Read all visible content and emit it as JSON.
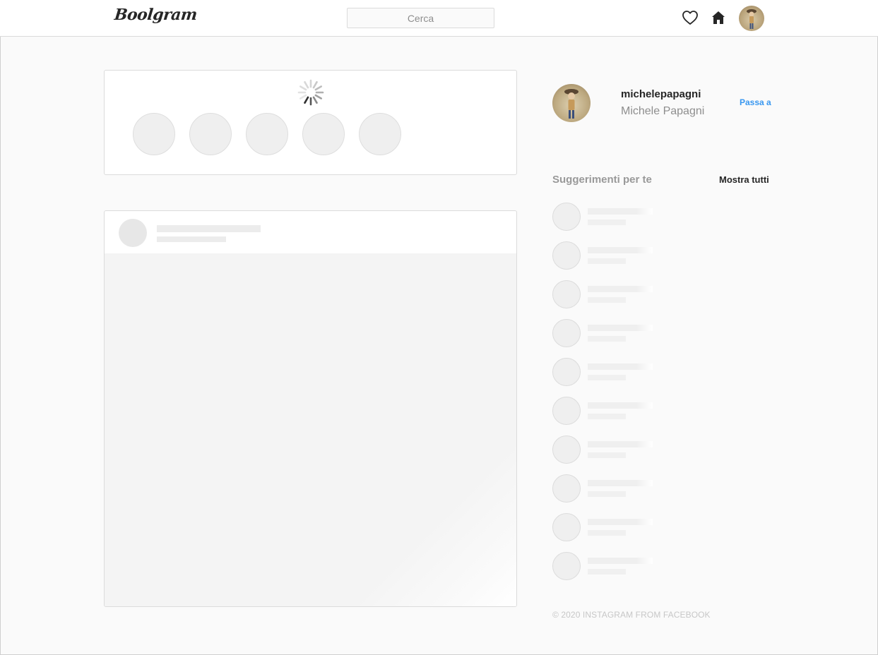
{
  "header": {
    "logo": "Boolgram",
    "search_placeholder": "Cerca",
    "icons": [
      "heart-icon",
      "home-icon",
      "profile-avatar"
    ]
  },
  "stories": {
    "loading_indicator": "spinner-icon",
    "placeholder_count": 5
  },
  "post": {
    "state": "loading-skeleton"
  },
  "profile": {
    "username": "michelepapagni",
    "full_name": "Michele Papagni",
    "switch_label": "Passa a"
  },
  "suggestions": {
    "title": "Suggerimenti per te",
    "show_all_label": "Mostra tutti",
    "placeholder_count": 10
  },
  "footer": {
    "copyright": "© 2020 INSTAGRAM FROM FACEBOOK"
  },
  "colors": {
    "link": "#3897f0",
    "border": "#dbdbdb",
    "background": "#fafafa",
    "skeleton": "#efefef"
  }
}
